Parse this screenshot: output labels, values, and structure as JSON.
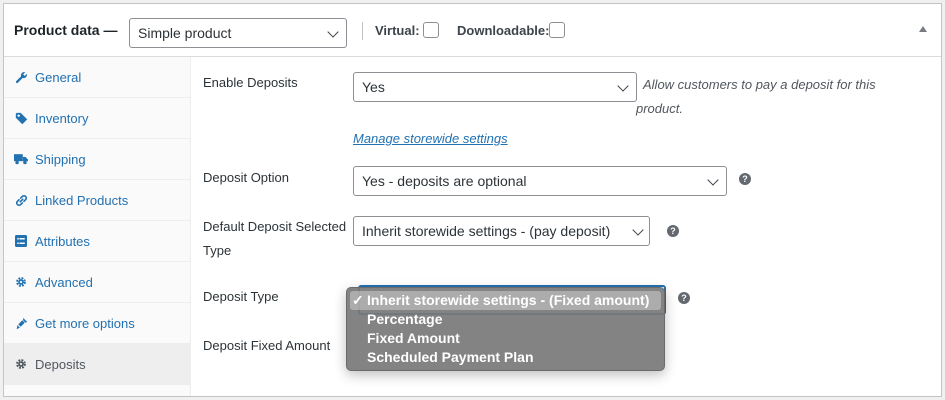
{
  "header": {
    "title": "Product data —",
    "product_type": "Simple product",
    "virtual_label": "Virtual:",
    "downloadable_label": "Downloadable:"
  },
  "sidebar": {
    "items": [
      {
        "label": "General",
        "icon": "wrench-icon"
      },
      {
        "label": "Inventory",
        "icon": "tag-icon"
      },
      {
        "label": "Shipping",
        "icon": "truck-icon"
      },
      {
        "label": "Linked Products",
        "icon": "link-icon"
      },
      {
        "label": "Attributes",
        "icon": "list-icon"
      },
      {
        "label": "Advanced",
        "icon": "gear-icon"
      },
      {
        "label": "Get more options",
        "icon": "plugin-icon"
      },
      {
        "label": "Deposits",
        "icon": "gear-icon",
        "active": true
      }
    ]
  },
  "fields": {
    "enable_deposits": {
      "label": "Enable Deposits",
      "value": "Yes",
      "description": "Allow customers to pay a deposit for this product.",
      "link": "Manage storewide settings"
    },
    "deposit_option": {
      "label": "Deposit Option",
      "value": "Yes - deposits are optional"
    },
    "default_type": {
      "label_line1": "Default Deposit Selected",
      "label_line2": "Type",
      "value": "Inherit storewide settings - (pay deposit)"
    },
    "deposit_type": {
      "label": "Deposit Type",
      "options": [
        "Inherit storewide settings - (Fixed amount)",
        "Percentage",
        "Fixed Amount",
        "Scheduled Payment Plan"
      ],
      "check_mark": "✓"
    },
    "fixed_amount": {
      "label": "Deposit Fixed Amount"
    }
  },
  "help_glyph": "?"
}
